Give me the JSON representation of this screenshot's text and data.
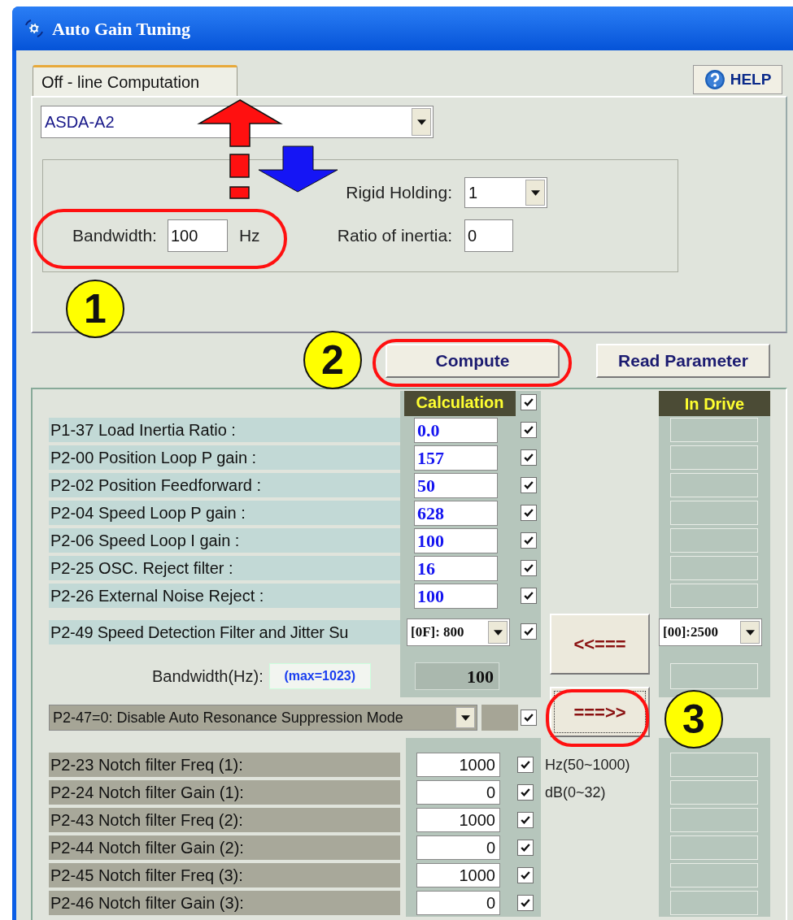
{
  "window": {
    "title": "Auto Gain Tuning"
  },
  "tabs": [
    {
      "label": "Off - line Computation",
      "selected": true
    }
  ],
  "help_button": "HELP",
  "model_select": {
    "value": "ASDA-A2"
  },
  "settings": {
    "rigid_holding": {
      "label": "Rigid Holding:",
      "value": "1"
    },
    "bandwidth": {
      "label": "Bandwidth:",
      "value": "100",
      "unit": "Hz"
    },
    "ratio_of_inertia": {
      "label": "Ratio of inertia:",
      "value": "0"
    }
  },
  "buttons": [
    "Compute",
    "Read Parameter"
  ],
  "results": {
    "header": "Calculation",
    "header_checked": true,
    "in_drive_header": "In Drive",
    "rows": [
      {
        "label": "P1-37 Load Inertia Ratio :",
        "value": "0.0",
        "checked": true
      },
      {
        "label": "P2-00 Position Loop P gain :",
        "value": "157",
        "checked": true
      },
      {
        "label": "P2-02 Position Feedforward :",
        "value": "50",
        "checked": true
      },
      {
        "label": "P2-04 Speed Loop P gain :",
        "value": "628",
        "checked": true
      },
      {
        "label": "P2-06 Speed Loop I gain :",
        "value": "100",
        "checked": true
      },
      {
        "label": "P2-25 OSC. Reject filter :",
        "value": "16",
        "checked": true
      },
      {
        "label": "P2-26 External Noise Reject :",
        "value": "100",
        "checked": true
      }
    ],
    "speed_filter": {
      "label": "P2-49 Speed Detection Filter and Jitter Su",
      "value": "[0F]: 800",
      "checked": true,
      "drive_value": "[00]:2500"
    },
    "bandwidth": {
      "label": "Bandwidth(Hz):",
      "hint": "(max=1023)",
      "value": "100"
    },
    "transfer_buttons": [
      "<<===",
      "===>>"
    ],
    "resonance": {
      "value": "P2-47=0: Disable Auto Resonance Suppression Mode",
      "checked": true
    },
    "notch_rows": [
      {
        "label": "P2-23 Notch filter Freq (1):",
        "value": "1000",
        "checked": true,
        "unit": "Hz(50~1000)"
      },
      {
        "label": "P2-24 Notch filter Gain (1):",
        "value": "0",
        "checked": true,
        "unit": "dB(0~32)"
      },
      {
        "label": "P2-43 Notch filter Freq (2):",
        "value": "1000",
        "checked": true
      },
      {
        "label": "P2-44 Notch filter Gain (2):",
        "value": "0",
        "checked": true
      },
      {
        "label": "P2-45 Notch filter Freq (3):",
        "value": "1000",
        "checked": true
      },
      {
        "label": "P2-46 Notch filter Gain (3):",
        "value": "0",
        "checked": true
      }
    ]
  },
  "callouts": [
    {
      "label": "1"
    },
    {
      "label": "2"
    },
    {
      "label": "3"
    }
  ]
}
